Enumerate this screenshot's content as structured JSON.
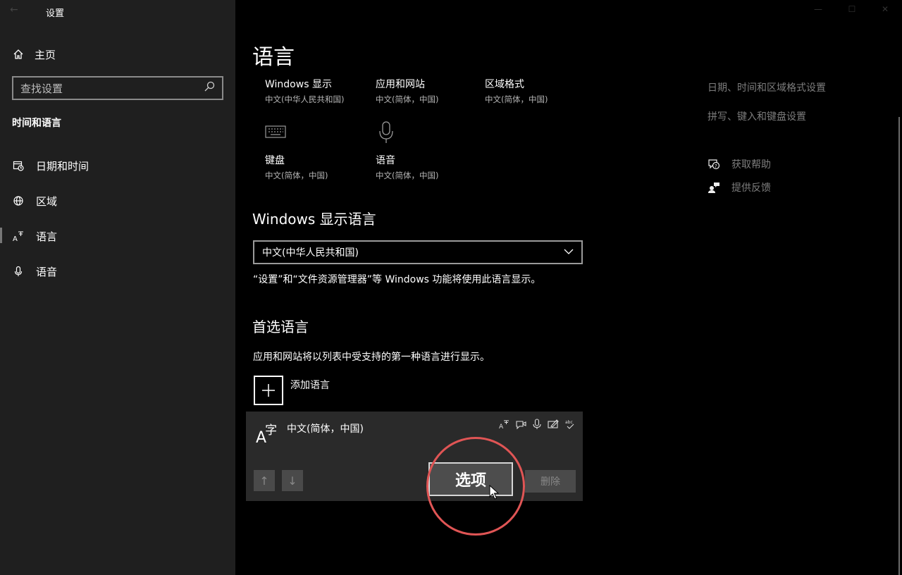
{
  "window": {
    "title": "设置",
    "back_glyph": "←",
    "controls": [
      "—",
      "☐",
      "✕"
    ]
  },
  "sidebar": {
    "home_label": "主页",
    "search_placeholder": "查找设置",
    "section_title": "时间和语言",
    "items": [
      {
        "label": "日期和时间",
        "icon": "calendar-clock-icon"
      },
      {
        "label": "区域",
        "icon": "globe-icon"
      },
      {
        "label": "语言",
        "icon": "language-icon",
        "active": true
      },
      {
        "label": "语音",
        "icon": "microphone-icon"
      }
    ]
  },
  "main": {
    "title": "语言",
    "tiles": [
      {
        "title": "Windows 显示",
        "sub": "中文(中华人民共和国)"
      },
      {
        "title": "应用和网站",
        "sub": "中文(简体，中国)"
      },
      {
        "title": "区域格式",
        "sub": "中文(简体，中国)"
      },
      {
        "title": "键盘",
        "sub": "中文(简体，中国)",
        "icon": "keyboard-icon"
      },
      {
        "title": "语音",
        "sub": "中文(简体，中国)",
        "icon": "microphone-icon"
      }
    ],
    "display_language": {
      "heading": "Windows 显示语言",
      "selected": "中文(中华人民共和国)",
      "description": "“设置”和“文件资源管理器”等 Windows 功能将使用此语言显示。"
    },
    "preferred": {
      "heading": "首选语言",
      "description": "应用和网站将以列表中受支持的第一种语言进行显示。",
      "add_label": "添加语言",
      "language": {
        "glyph_a": "A",
        "glyph_zi": "字",
        "name": "中文(简体，中国)",
        "feature_icons": [
          "display-language-icon",
          "speech-icon",
          "voice-icon",
          "handwriting-icon",
          "spellcheck-icon"
        ],
        "up_glyph": "↑",
        "down_glyph": "↓",
        "options_label": "选项",
        "delete_label": "删除"
      }
    }
  },
  "right_panel": {
    "links": [
      "日期、时间和区域格式设置",
      "拼写、键入和键盘设置"
    ],
    "help_label": "获取帮助",
    "feedback_label": "提供反馈"
  },
  "colors": {
    "highlight_circle": "#e05555",
    "sidebar_bg": "#1f1f1f",
    "card_bg": "#2a2a2a"
  }
}
